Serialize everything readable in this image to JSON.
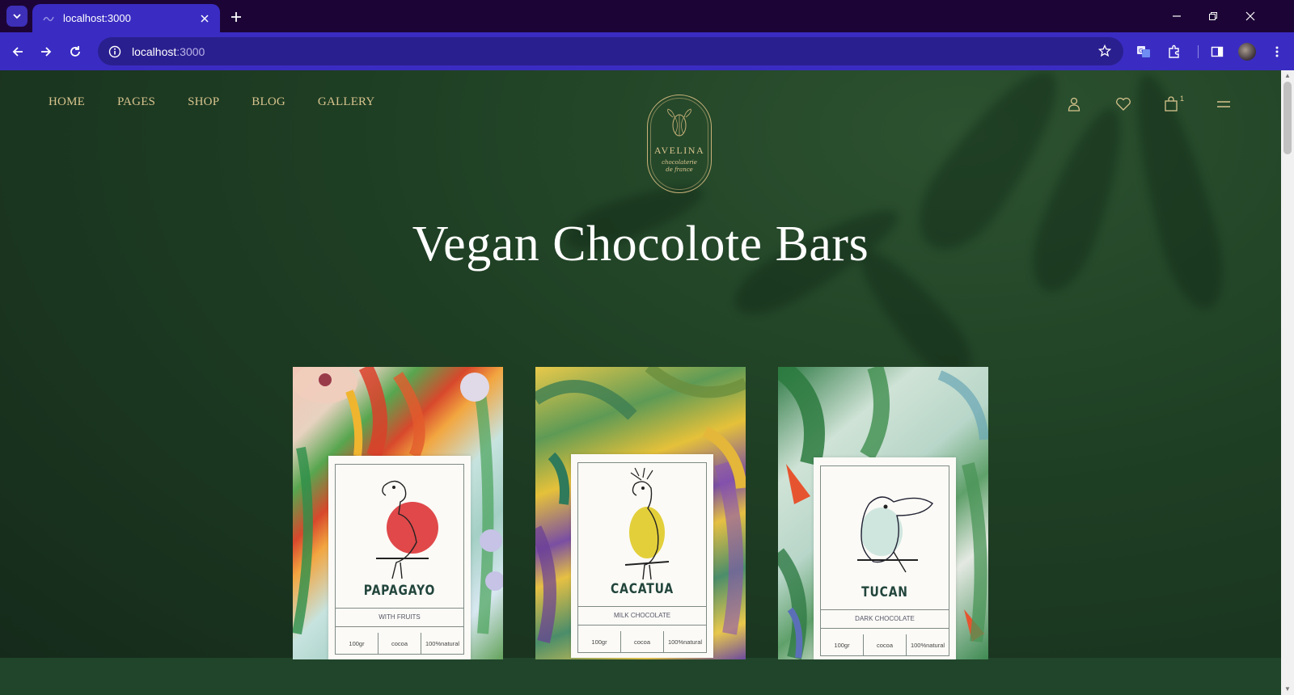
{
  "browser": {
    "tab_title": "localhost:3000",
    "url_host": "localhost",
    "url_port": ":3000"
  },
  "nav": {
    "items": [
      "HOME",
      "PAGES",
      "SHOP",
      "BLOG",
      "GALLERY"
    ]
  },
  "logo": {
    "brand": "AVELINA",
    "tagline": "chocolaterie de france"
  },
  "header": {
    "cart_count": "1"
  },
  "hero": {
    "title": "Vegan Chocolote Bars"
  },
  "products": [
    {
      "name": "PAPAGAYO",
      "type": "WITH FRUITS",
      "weight": "100gr",
      "ingredient": "cocoa",
      "natural": "100%natural",
      "accent": "#e0484a"
    },
    {
      "name": "CACATUA",
      "type": "MILK CHOCOLATE",
      "weight": "100gr",
      "ingredient": "cocoa",
      "natural": "100%natural",
      "accent": "#e3cf3a"
    },
    {
      "name": "TUCAN",
      "type": "DARK CHOCOLATE",
      "weight": "100gr",
      "ingredient": "cocoa",
      "natural": "100%natural",
      "accent": "#cfe6df"
    }
  ],
  "colors": {
    "chrome_dark": "#1c0536",
    "chrome_accent": "#3a2cc2",
    "page_bg": "#1f4024",
    "nav_gold": "#d8c48e",
    "title_white": "#ffffff"
  },
  "icons": [
    "back-icon",
    "forward-icon",
    "reload-icon",
    "info-icon",
    "star-icon",
    "translate-icon",
    "extensions-icon",
    "sidepanel-icon",
    "menu-dots-icon",
    "user-icon",
    "heart-icon",
    "bag-icon",
    "hamburger-icon"
  ]
}
